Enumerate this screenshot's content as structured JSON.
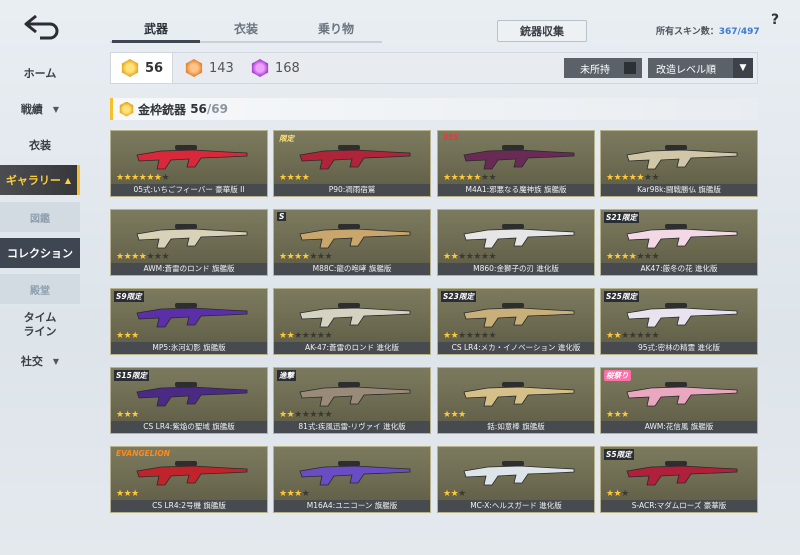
{
  "sidebar": {
    "back_icon": "back-arrow-icon",
    "items": [
      {
        "label": "ホーム",
        "arrow": ""
      },
      {
        "label": "戦績",
        "arrow": "▼"
      },
      {
        "label": "衣装",
        "arrow": ""
      },
      {
        "label": "ギャラリー",
        "arrow": "▲"
      },
      {
        "label": "図鑑",
        "arrow": ""
      },
      {
        "label": "コレクション",
        "arrow": ""
      },
      {
        "label": "殿堂",
        "arrow": ""
      },
      {
        "label": "タイム\nライン",
        "arrow": ""
      },
      {
        "label": "社交",
        "arrow": "▼"
      }
    ]
  },
  "tabs": [
    "武器",
    "衣装",
    "乗り物"
  ],
  "collect_button": "銃器収集",
  "owned_skins": {
    "label": "所有スキン数：",
    "owned": "367",
    "total": "/497"
  },
  "help": "?",
  "filters": {
    "counts": [
      "56",
      "143",
      "168"
    ],
    "unowned_label": "未所持",
    "sort_label": "改造レベル順",
    "sort_arrow": "▼"
  },
  "section": {
    "title": "金枠銃器",
    "owned": "56",
    "total": "/69"
  },
  "cards": [
    {
      "name": "05式:いちごフィーバー 豪華版 II",
      "stars": 6,
      "max": 7,
      "badge": "",
      "gun_color": "#d9283a"
    },
    {
      "name": "P90:凋雨宿鷲",
      "stars": 4,
      "max": 4,
      "badge": "限定",
      "badge_class": "gold",
      "gun_color": "#b0243a"
    },
    {
      "name": "M4A1:邪悪なる魔神族 旗艦版",
      "stars": 5,
      "max": 7,
      "badge": "SSS",
      "badge_class": "brand",
      "gun_color": "#6a2a56"
    },
    {
      "name": "Kar98k:闘戦勝仏 旗艦版",
      "stars": 5,
      "max": 7,
      "badge": "",
      "gun_color": "#cfc7a8"
    },
    {
      "name": "AWM:蒼雷のロンド 旗艦版",
      "stars": 4,
      "max": 7,
      "badge": "",
      "gun_color": "#d8d2b8"
    },
    {
      "name": "M88C:龍の咆哮 旗艦版",
      "stars": 4,
      "max": 7,
      "badge": "S",
      "badge_class": "season",
      "gun_color": "#c9a66b"
    },
    {
      "name": "M860:金獅子の刃 進化版",
      "stars": 2,
      "max": 7,
      "badge": "",
      "gun_color": "#e6e6e6"
    },
    {
      "name": "AK47:厳冬の花 進化版",
      "stars": 4,
      "max": 7,
      "badge": "S21限定",
      "badge_class": "season",
      "gun_color": "#f3d9e6"
    },
    {
      "name": "MP5:氷河幻影 旗艦版",
      "stars": 3,
      "max": 3,
      "badge": "S9限定",
      "badge_class": "season",
      "gun_color": "#5b2fa8"
    },
    {
      "name": "AK-47:蒼雷のロンド 進化版",
      "stars": 2,
      "max": 7,
      "badge": "",
      "gun_color": "#d6d2c2"
    },
    {
      "name": "CS LR4:メカ・イノベーション 進化版",
      "stars": 2,
      "max": 7,
      "badge": "S23限定",
      "badge_class": "season",
      "gun_color": "#c9b07a"
    },
    {
      "name": "95式:密林の精霊 進化版",
      "stars": 2,
      "max": 7,
      "badge": "S25限定",
      "badge_class": "season",
      "gun_color": "#e9e3f0"
    },
    {
      "name": "CS LR4:紫焔の聖域 旗艦版",
      "stars": 3,
      "max": 3,
      "badge": "S15限定",
      "badge_class": "season",
      "gun_color": "#4b2a86"
    },
    {
      "name": "81式:疾風迅雷-リヴァイ 進化版",
      "stars": 2,
      "max": 7,
      "badge": "進撃",
      "badge_class": "season",
      "gun_color": "#9a8a78"
    },
    {
      "name": "銛:如意棒 旗艦版",
      "stars": 3,
      "max": 3,
      "badge": "",
      "gun_color": "#d6c08a"
    },
    {
      "name": "AWM:花信風 旗艦版",
      "stars": 3,
      "max": 3,
      "badge": "桜祭り",
      "badge_class": "pink",
      "gun_color": "#e9a8c0"
    },
    {
      "name": "CS LR4:2号機 旗艦版",
      "stars": 3,
      "max": 3,
      "badge": "EVANGELION",
      "badge_class": "evangelion",
      "gun_color": "#c0242a"
    },
    {
      "name": "M16A4:ユニコーン 旗艦版",
      "stars": 3,
      "max": 4,
      "badge": "",
      "gun_color": "#6a4cc4"
    },
    {
      "name": "MC-X:ヘルスガード 進化版",
      "stars": 2,
      "max": 3,
      "badge": "",
      "gun_color": "#dde4ea"
    },
    {
      "name": "S-ACR:マダムローズ 豪華版",
      "stars": 2,
      "max": 3,
      "badge": "S5限定",
      "badge_class": "season",
      "gun_color": "#b0203a"
    }
  ],
  "colors": {
    "accent": "#f5c02a",
    "nav_dark": "#3d4651",
    "card_bg": "#6c6a50"
  }
}
